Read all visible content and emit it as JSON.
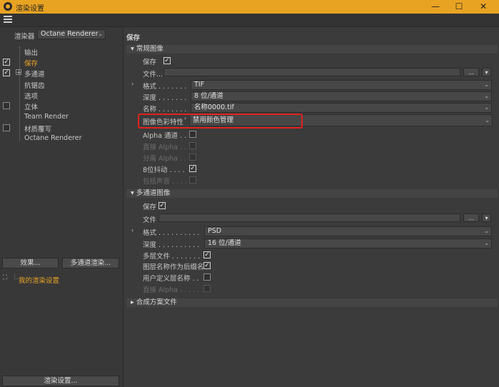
{
  "window": {
    "title": "渲染设置"
  },
  "left": {
    "renderer_label": "渲染器",
    "renderer_value": "Octane Renderer",
    "tree": [
      "输出",
      "保存",
      "多通道",
      "抗锯齿",
      "选项",
      "立体",
      "Team Render",
      "材质覆写",
      "Octane Renderer"
    ],
    "effects_button": "效果...",
    "multipass_button": "多通道渲染...",
    "preset_label": "我的渲染设置",
    "render_settings_button": "渲染设置..."
  },
  "right": {
    "title": "保存",
    "regular": {
      "header": "常规图像",
      "save_label": "保存",
      "file_label": "文件...",
      "format_label": "格式 . . . . . . .",
      "format_value": "TIF",
      "depth_label": "深度 . . . . . . .",
      "depth_value": "8 位/通道",
      "name_label": "名称 . . . . . . .",
      "name_value": "名称0000.tif",
      "color_profile_label": "图像色彩特性",
      "color_profile_value": "禁用颜色管理",
      "alpha_label": "Alpha 通道 . .",
      "straight_alpha_label": "直接 Alpha . .",
      "separate_alpha_label": "分离 Alpha . .",
      "dither_label": "8位抖动 . . . .",
      "include_sound_label": "包括声音 . . . ."
    },
    "multipass": {
      "header": "多通道图像",
      "save_label": "保存",
      "file_label": "文件",
      "format_label": "格式 . . . . . . . . . .",
      "format_value": "PSD",
      "depth_label": "深度 . . . . . . . . . .",
      "depth_value": "16 位/通道",
      "multilayer_label": "多层文件 . . . . . . .",
      "layer_name_label": "图层名称作为后缀名",
      "user_layer_label": "用户定义层名称 . .",
      "straight_alpha_label": "直接 Alpha . . . . ."
    },
    "compositing": {
      "header": "合成方案文件"
    },
    "ellipsis": "...",
    "small_arrow": "▾"
  },
  "colors": {
    "accent": "#e8a323",
    "highlight_box": "#e0231f"
  }
}
